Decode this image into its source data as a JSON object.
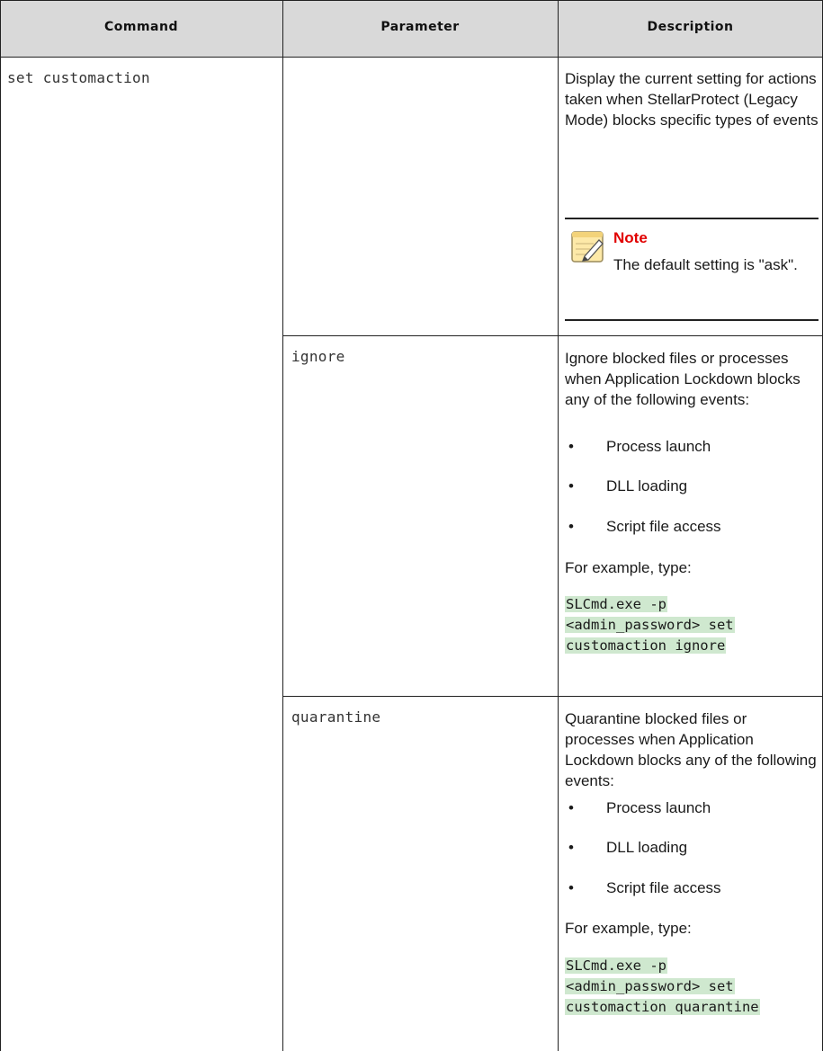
{
  "headers": {
    "command": "Command",
    "parameter": "Parameter",
    "description": "Description"
  },
  "command": "set customaction",
  "row1": {
    "description": "Display the current setting for actions taken when StellarProtect (Legacy Mode) blocks specific types of events",
    "note_title": "Note",
    "note_text": "The default setting is \"ask\"."
  },
  "row2": {
    "parameter": "ignore",
    "intro": "Ignore blocked files or processes when Application Lockdown blocks any of the following events:",
    "bullets": [
      "Process launch",
      "DLL loading",
      "Script file access"
    ],
    "example_label": "For example, type:",
    "code_lines": [
      "SLCmd.exe -p",
      "<admin_password> set",
      "customaction ignore"
    ]
  },
  "row3": {
    "parameter": "quarantine",
    "intro": "Quarantine blocked files or processes when Application Lockdown blocks any of the following events:",
    "bullets": [
      "Process launch",
      "DLL loading",
      "Script file access"
    ],
    "example_label": "For example, type:",
    "code_lines": [
      "SLCmd.exe -p",
      "<admin_password> set",
      "customaction quarantine"
    ]
  },
  "colors": {
    "header_bg": "#d9d9d9",
    "note_red": "#e10000",
    "code_highlight": "#cfe8cf"
  }
}
